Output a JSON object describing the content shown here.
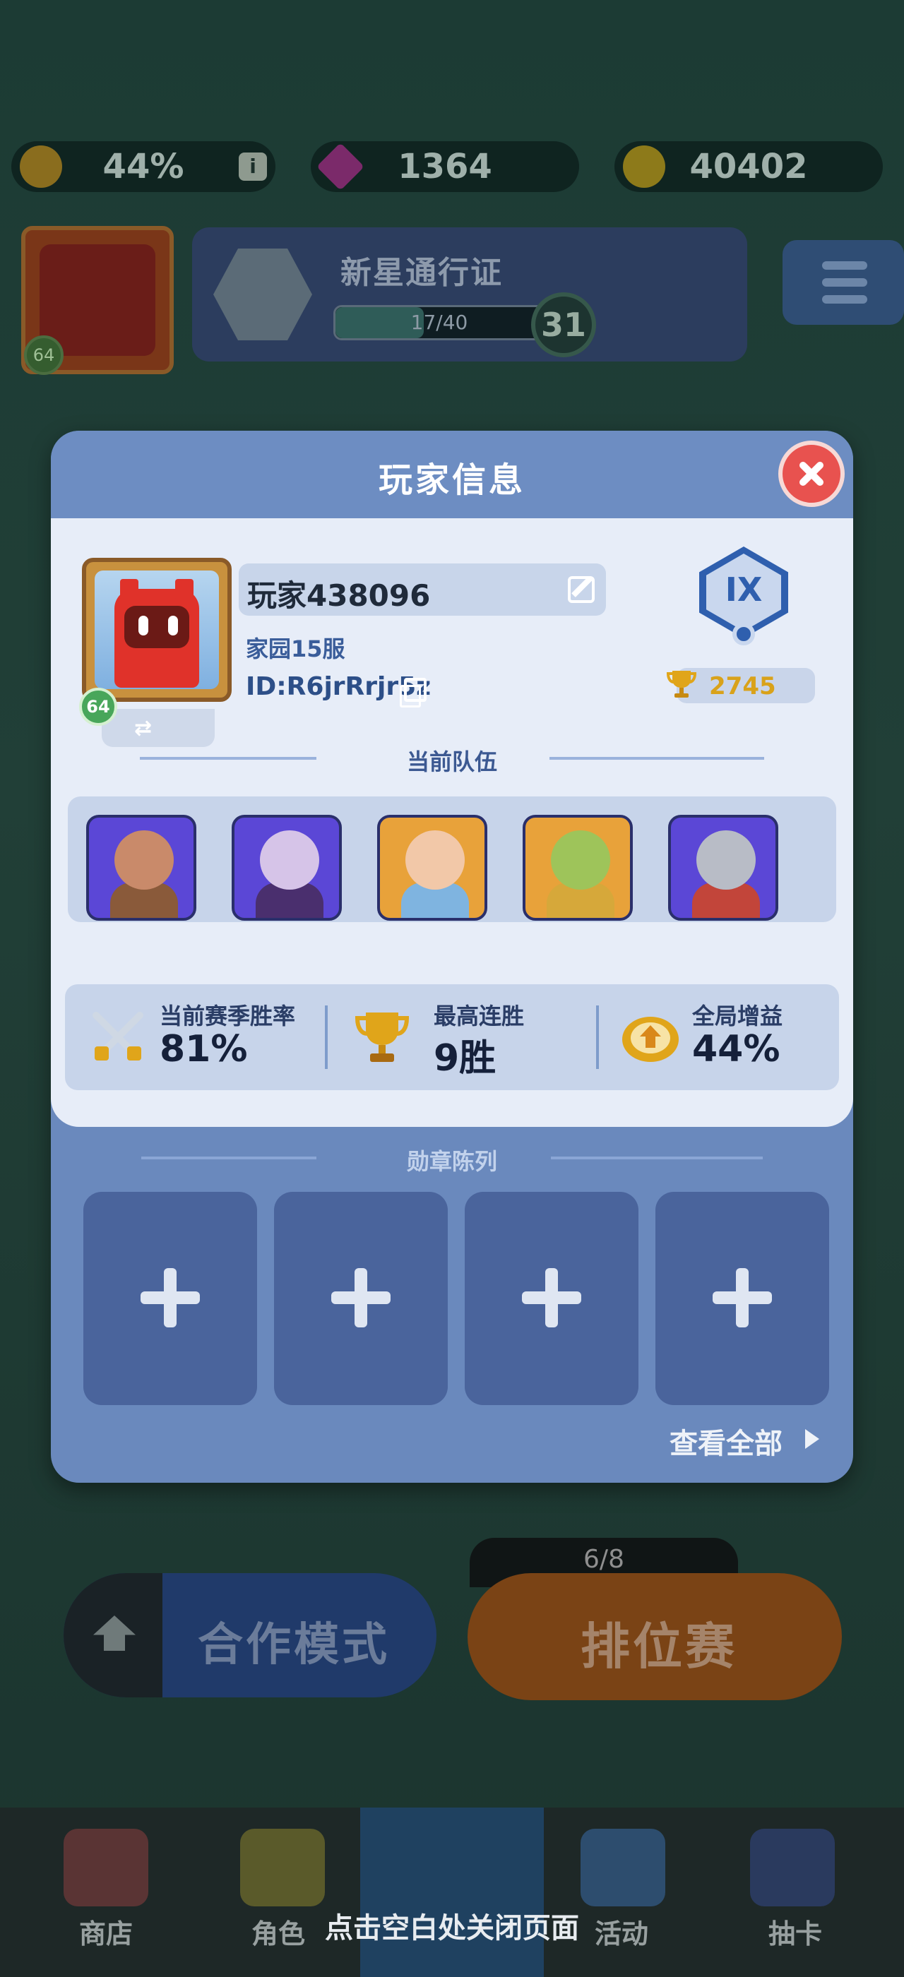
{
  "top_bar": {
    "boost_percent": "44%",
    "gems": "1364",
    "coins": "40402"
  },
  "background": {
    "player_level": "64",
    "pass_title": "新星通行证",
    "pass_progress_text": "17/40",
    "pass_progress_fraction": 0.425,
    "pass_level": "31",
    "coop_label": "合作模式",
    "ranked_label": "排位赛",
    "ranked_count": "6/8",
    "nav": [
      "商店",
      "角色",
      "活动",
      "抽卡"
    ],
    "close_hint": "点击空白处关闭页面"
  },
  "modal": {
    "title": "玩家信息",
    "player_name": "玩家438096",
    "server": "家园15服",
    "player_id": "ID:R6jrRrjr5z",
    "level": "64",
    "rank_numeral": "IX",
    "trophies": "2745",
    "team_section_title": "当前队伍",
    "team": [
      {
        "name": "orc-warrior",
        "bg": "#5b47d6",
        "head": "#c98a6a",
        "body": "#8a5a3a"
      },
      {
        "name": "shadow-mage",
        "bg": "#5b47d6",
        "head": "#d6c4e8",
        "body": "#4a2f6e"
      },
      {
        "name": "ice-priestess",
        "bg": "#e8a23a",
        "head": "#f2c8a8",
        "body": "#7fb4e0"
      },
      {
        "name": "forest-king",
        "bg": "#e8a23a",
        "head": "#9ec45a",
        "body": "#d6a83a"
      },
      {
        "name": "armored-knight",
        "bg": "#5b47d6",
        "head": "#b8bcc6",
        "body": "#c2453a"
      }
    ],
    "stats": [
      {
        "label": "当前赛季胜率",
        "value": "81%",
        "icon": "crossed-swords-icon"
      },
      {
        "label": "最高连胜",
        "value": "9胜",
        "icon": "trophy-icon"
      },
      {
        "label": "全局增益",
        "value": "44%",
        "icon": "boost-crown-icon"
      }
    ],
    "badges_section_title": "勋章陈列",
    "badge_slots": 4,
    "view_all": "查看全部"
  },
  "colors": {
    "modal_frame": "#6a89bd",
    "modal_body": "#e7edf8",
    "close_button": "#e8524f",
    "trophy_gold": "#d9a21a"
  }
}
